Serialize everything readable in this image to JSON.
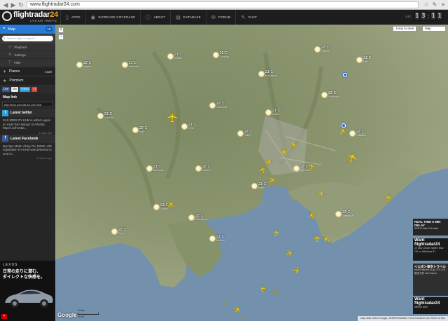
{
  "browser": {
    "url": "www.flightradar24.com"
  },
  "header": {
    "logo_main": "flightradar",
    "logo_num": "24",
    "logo_sub": "LIVE AIR TRAFFIC",
    "nav": [
      {
        "label": "APPS",
        "icon": "phone-icon"
      },
      {
        "label": "INCREASE COVERAGE",
        "icon": "antenna-icon"
      },
      {
        "label": "ABOUT",
        "icon": "info-icon"
      },
      {
        "label": "DATABASE",
        "icon": "database-icon"
      },
      {
        "label": "FORUM",
        "icon": "forum-icon"
      },
      {
        "label": "CHAT",
        "icon": "chat-icon"
      }
    ],
    "clock_label": "UTC",
    "clock": [
      "1",
      "3",
      "1",
      "1"
    ]
  },
  "sidebar": {
    "map_label": "Map",
    "map_badge": "10",
    "search_placeholder": "Search flight or airport...",
    "sub_items": [
      "Playback",
      "Settings",
      "Filter"
    ],
    "planes_label": "Planes",
    "planes_count": "4320",
    "premium_label": "Premium",
    "social": [
      "Like",
      "25k",
      "Follow",
      "+1"
    ],
    "map_link_label": "Map link",
    "map_link_value": "http://fr24.com/35.45,139.24/8",
    "twitter_title": "Latest twitter",
    "twitter_text": "SAS MD82 OY-KHM is airborn again en route from Bangor to Arlanda. http://t.co/hVxBa...",
    "twitter_time": "1 days ago",
    "facebook_title": "Latest Facebook",
    "facebook_text": "Bye Bye Malte Viking The MD82, with registration OY-KHM was delivered to SAS in...",
    "facebook_time": "19 hours ago"
  },
  "ad_left": {
    "brand": "LEXUS",
    "line1": "日常の走りに潜む、",
    "line2": "ダイレクトな快感を。"
  },
  "map": {
    "jump_label": "Jump to area",
    "type_label": "Map",
    "google": "Google",
    "scale_km": "20 km",
    "scale_mi": "10 mi",
    "attribution": "Map data ©2013 Google, ZENRIN  Weather ©2013 weather.com  Terms of Use",
    "weather": [
      {
        "t": "22°C",
        "p": "Nagano"
      },
      {
        "t": "21°C",
        "p": "Maebashi"
      },
      {
        "t": "21°C",
        "p": "Isesaki"
      },
      {
        "t": "22°C",
        "p": "Tomioka"
      },
      {
        "t": "21°C",
        "p": "Kumagaya"
      },
      {
        "t": "22°C",
        "p": "Oyama"
      },
      {
        "t": "21°C",
        "p": "Mito"
      },
      {
        "t": "22°C",
        "p": "Tsuchiura"
      },
      {
        "t": "21°C",
        "p": "Chichibu"
      },
      {
        "t": "22°C",
        "p": "Kofu"
      },
      {
        "t": "21°C",
        "p": "Ome"
      },
      {
        "t": "22°C",
        "p": "Tokyo"
      },
      {
        "t": "21°C",
        "p": "Chiba"
      },
      {
        "t": "22°C",
        "p": "Yokohama"
      },
      {
        "t": "22°C",
        "p": "Odawara"
      },
      {
        "t": "21°C",
        "p": "Shizuoka"
      },
      {
        "t": "22°C",
        "p": "Numazu"
      },
      {
        "t": "21°C",
        "p": "Atami"
      },
      {
        "t": "22°C",
        "p": "Shimoda"
      },
      {
        "t": "22°C",
        "p": "Tateyama"
      },
      {
        "t": "21°C",
        "p": "Choshi"
      },
      {
        "t": "22°C",
        "p": "Kamogawa"
      },
      {
        "t": "21°C",
        "p": "Mobara"
      },
      {
        "t": "22°C",
        "p": "Fuji"
      }
    ]
  },
  "ads_right": [
    {
      "t1": "REAL TIME  5 MIN DELAY",
      "t2": "ADS-B data  FAA data"
    },
    {
      "t1": "Want flightradar24",
      "t2": "on your phone, tablet, Mac OS, or Windows 8?"
    },
    {
      "t1": "＜公式＞東京トラベル",
      "t2": "travel.rakuten.co.jp  ホテルを格安予約 AdChoices"
    },
    {
      "t1": "Want flightradar24",
      "t2": "without ads?"
    }
  ]
}
